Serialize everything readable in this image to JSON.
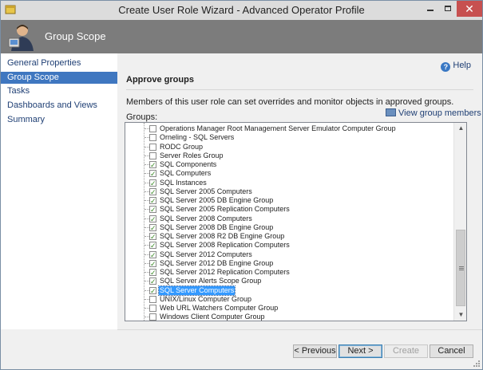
{
  "window": {
    "title": "Create User Role Wizard - Advanced Operator Profile",
    "close_glyph": "✕"
  },
  "banner": {
    "title": "Group Scope",
    "icon": "user-wizard-icon"
  },
  "nav": {
    "items": [
      {
        "label": "General Properties",
        "active": false
      },
      {
        "label": "Group Scope",
        "active": true
      },
      {
        "label": "Tasks",
        "active": false
      },
      {
        "label": "Dashboards and Views",
        "active": false
      },
      {
        "label": "Summary",
        "active": false
      }
    ]
  },
  "content": {
    "help_label": "Help",
    "section_title": "Approve groups",
    "description": "Members of this user role can set overrides and monitor objects in approved groups.",
    "view_members_label": "View group members",
    "groups_label": "Groups:",
    "groups": [
      {
        "label": "Operations Manager Root Management Server Emulator Computer Group",
        "checked": false,
        "selected": false
      },
      {
        "label": "Orneling - SQL Servers",
        "checked": false,
        "selected": false
      },
      {
        "label": "RODC Group",
        "checked": false,
        "selected": false
      },
      {
        "label": "Server Roles Group",
        "checked": false,
        "selected": false
      },
      {
        "label": "SQL Components",
        "checked": true,
        "selected": false
      },
      {
        "label": "SQL Computers",
        "checked": true,
        "selected": false
      },
      {
        "label": "SQL Instances",
        "checked": true,
        "selected": false
      },
      {
        "label": "SQL Server 2005 Computers",
        "checked": true,
        "selected": false
      },
      {
        "label": "SQL Server 2005 DB Engine Group",
        "checked": true,
        "selected": false
      },
      {
        "label": "SQL Server 2005 Replication Computers",
        "checked": true,
        "selected": false
      },
      {
        "label": "SQL Server 2008 Computers",
        "checked": true,
        "selected": false
      },
      {
        "label": "SQL Server 2008 DB Engine Group",
        "checked": true,
        "selected": false
      },
      {
        "label": "SQL Server 2008 R2 DB Engine Group",
        "checked": true,
        "selected": false
      },
      {
        "label": "SQL Server 2008 Replication Computers",
        "checked": true,
        "selected": false
      },
      {
        "label": "SQL Server 2012 Computers",
        "checked": true,
        "selected": false
      },
      {
        "label": "SQL Server 2012 DB Engine Group",
        "checked": true,
        "selected": false
      },
      {
        "label": "SQL Server 2012 Replication Computers",
        "checked": true,
        "selected": false
      },
      {
        "label": "SQL Server Alerts Scope Group",
        "checked": true,
        "selected": false
      },
      {
        "label": "SQL Server Computers",
        "checked": true,
        "selected": true
      },
      {
        "label": "UNIX/Linux Computer Group",
        "checked": false,
        "selected": false
      },
      {
        "label": "Web URL Watchers Computer Group",
        "checked": false,
        "selected": false
      },
      {
        "label": "Windows Client Computer Group",
        "checked": false,
        "selected": false
      }
    ],
    "scroll_up_glyph": "▲",
    "scroll_down_glyph": "▼"
  },
  "footer": {
    "previous_label": "< Previous",
    "next_label": "Next >",
    "create_label": "Create",
    "cancel_label": "Cancel"
  },
  "colors": {
    "banner_bg": "#7c7c7c",
    "nav_active_bg": "#3f77c0",
    "selection_bg": "#3399ff",
    "close_bg": "#c75050"
  }
}
